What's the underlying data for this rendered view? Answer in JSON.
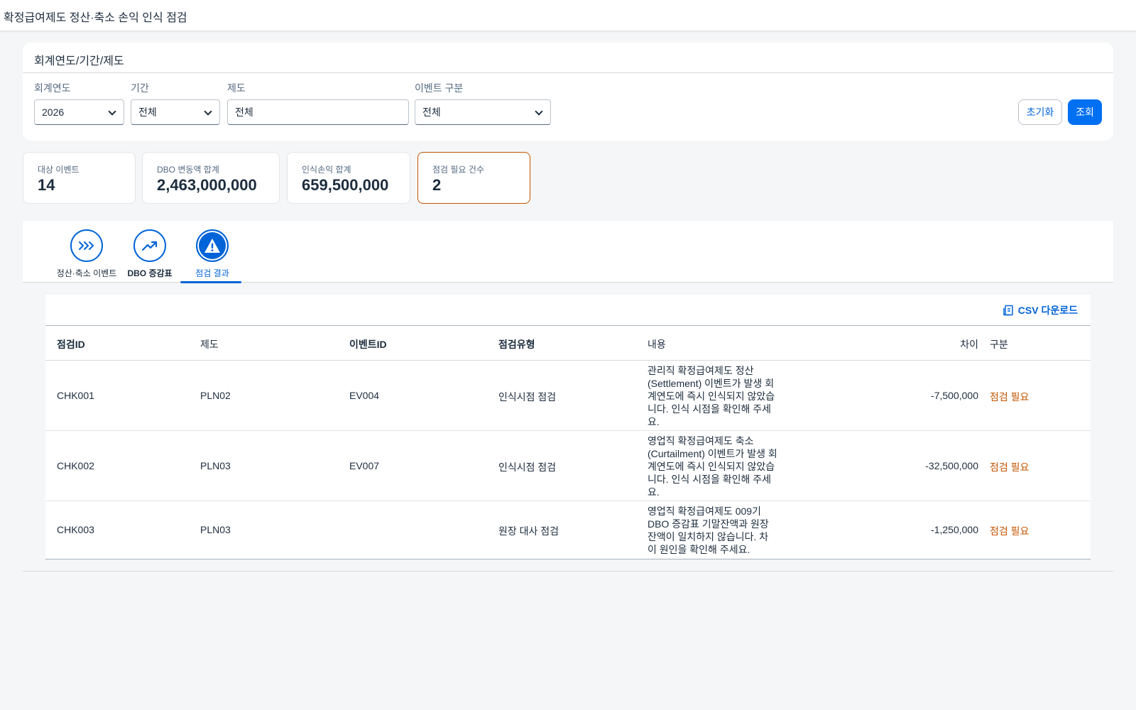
{
  "shell": {
    "title": "확정급여제도 정산·축소 손익 인식 점검"
  },
  "filters": {
    "title": "회계연도/기간/제도",
    "fiscal_year": {
      "label": "회계연도",
      "value": "2026"
    },
    "period": {
      "label": "기간",
      "value": "전체"
    },
    "plan": {
      "label": "제도",
      "value": "전체"
    },
    "event_type": {
      "label": "이벤트 구분",
      "value": "전체"
    },
    "reset_label": "초기화",
    "search_label": "조회"
  },
  "kpis": [
    {
      "label": "대상 이벤트",
      "value": "14"
    },
    {
      "label": "DBO 변동액 합계",
      "value": "2,463,000,000"
    },
    {
      "label": "인식손익 합계",
      "value": "659,500,000"
    },
    {
      "label": "점검 필요 건수",
      "value": "2"
    }
  ],
  "tabs": [
    {
      "label": "정산·축소 이벤트",
      "icon": "chevrons-right-icon"
    },
    {
      "label": "DBO 증감표",
      "icon": "trend-up-icon"
    },
    {
      "label": "점검 결과",
      "icon": "warning-icon"
    }
  ],
  "table": {
    "csv_label": "CSV 다운로드",
    "columns": [
      "점검ID",
      "제도",
      "이벤트ID",
      "점검유형",
      "내용",
      "차이",
      "구분"
    ],
    "rows": [
      {
        "id": "CHK001",
        "plan": "PLN02",
        "event": "EV004",
        "type": "인식시점 점검",
        "desc": [
          "관리직 확정급여제도 정산",
          "(Settlement) 이벤트가 발생 회",
          "계연도에 즉시 인식되지 않았습",
          "니다. 인식 시점을 확인해 주세",
          "요."
        ],
        "diff": "-7,500,000",
        "status": "점검 필요"
      },
      {
        "id": "CHK002",
        "plan": "PLN03",
        "event": "EV007",
        "type": "인식시점 점검",
        "desc": [
          "영업직 확정급여제도 축소",
          "(Curtailment) 이벤트가 발생 회",
          "계연도에 즉시 인식되지 않았습",
          "니다. 인식 시점을 확인해 주세",
          "요."
        ],
        "diff": "-32,500,000",
        "status": "점검 필요"
      },
      {
        "id": "CHK003",
        "plan": "PLN03",
        "event": "",
        "type": "원장 대사 점검",
        "desc": [
          "영업직 확정급여제도 009기",
          "DBO 증감표 기말잔액과 원장",
          "잔액이 일치하지 않습니다. 차",
          "이 원인을 확인해 주세요."
        ],
        "diff": "-1,250,000",
        "status": "점검 필요"
      }
    ]
  },
  "colors": {
    "accent": "#0070f2",
    "link": "#0064d9",
    "warning": "#c35500"
  }
}
